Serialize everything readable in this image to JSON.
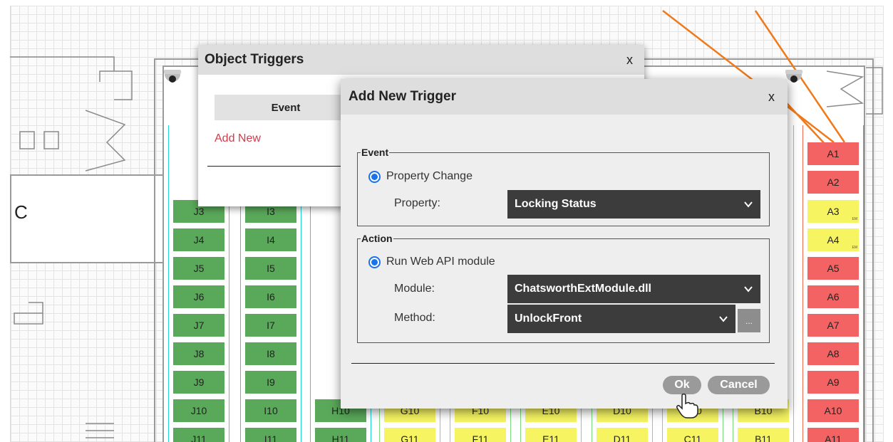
{
  "floorplan": {
    "room_label": "C",
    "rack_columns": [
      {
        "border_color": "#22d3d3",
        "slots": [
          {
            "label": "J3",
            "color": "green"
          },
          {
            "label": "J4",
            "color": "green"
          },
          {
            "label": "J5",
            "color": "green"
          },
          {
            "label": "J6",
            "color": "green"
          },
          {
            "label": "J7",
            "color": "green"
          },
          {
            "label": "J8",
            "color": "green"
          },
          {
            "label": "J9",
            "color": "green"
          },
          {
            "label": "J10",
            "color": "green"
          },
          {
            "label": "J11",
            "color": "green"
          }
        ]
      },
      {
        "border_color": "#22d3d3",
        "slots": [
          {
            "label": "I3",
            "color": "green"
          },
          {
            "label": "I4",
            "color": "green"
          },
          {
            "label": "I5",
            "color": "green"
          },
          {
            "label": "I6",
            "color": "green"
          },
          {
            "label": "I7",
            "color": "green"
          },
          {
            "label": "I8",
            "color": "green"
          },
          {
            "label": "I9",
            "color": "green"
          },
          {
            "label": "I10",
            "color": "green"
          },
          {
            "label": "I11",
            "color": "green"
          }
        ]
      },
      {
        "border_color": "#22d3d3",
        "slots": [
          {
            "label": "H10",
            "color": "green"
          },
          {
            "label": "H11",
            "color": "green"
          }
        ]
      },
      {
        "border_color": "#7ddc7d",
        "slots": [
          {
            "label": "G10",
            "color": "yellow"
          },
          {
            "label": "G11",
            "color": "yellow"
          }
        ]
      },
      {
        "border_color": "#7ddc7d",
        "slots": [
          {
            "label": "F10",
            "color": "yellow"
          },
          {
            "label": "F11",
            "color": "yellow"
          }
        ]
      },
      {
        "border_color": "#7ddc7d",
        "slots": [
          {
            "label": "E10",
            "color": "yellow"
          },
          {
            "label": "E11",
            "color": "yellow"
          }
        ]
      },
      {
        "border_color": "#7ddc7d",
        "slots": [
          {
            "label": "D10",
            "color": "yellow"
          },
          {
            "label": "D11",
            "color": "yellow"
          }
        ]
      },
      {
        "border_color": "#7ddc7d",
        "slots": [
          {
            "label": "C10",
            "color": "yellow"
          },
          {
            "label": "C11",
            "color": "yellow"
          }
        ]
      },
      {
        "border_color": "#7ddc7d",
        "slots": [
          {
            "label": "B10",
            "color": "yellow"
          },
          {
            "label": "B11",
            "color": "yellow"
          }
        ]
      },
      {
        "border_color": "#f06a50",
        "slots": [
          {
            "label": "A1",
            "color": "red"
          },
          {
            "label": "A2",
            "color": "red"
          },
          {
            "label": "A3",
            "color": "yellow",
            "tag": "EM"
          },
          {
            "label": "A4",
            "color": "yellow",
            "tag": "EM"
          },
          {
            "label": "A5",
            "color": "red"
          },
          {
            "label": "A6",
            "color": "red"
          },
          {
            "label": "A7",
            "color": "red"
          },
          {
            "label": "A8",
            "color": "red"
          },
          {
            "label": "A9",
            "color": "red"
          },
          {
            "label": "A10",
            "color": "red"
          },
          {
            "label": "A11",
            "color": "red"
          }
        ]
      }
    ],
    "colors": {
      "green": "#5aa85a",
      "yellow": "#f6f461",
      "red": "#f36363",
      "connection_line": "#f07a1a"
    }
  },
  "object_triggers_dialog": {
    "title": "Object Triggers",
    "close_label": "x",
    "table_header": "Event",
    "add_new_link": "Add New"
  },
  "add_trigger_dialog": {
    "title": "Add New Trigger",
    "close_label": "x",
    "event_group": {
      "legend": "Event",
      "option": "Property Change",
      "property_label": "Property:",
      "property_value": "Locking Status"
    },
    "action_group": {
      "legend": "Action",
      "option": "Run Web API module",
      "module_label": "Module:",
      "module_value": "ChatsworthExtModule.dll",
      "method_label": "Method:",
      "method_value": "UnlockFront",
      "more_button": "..."
    },
    "ok_button": "Ok",
    "cancel_button": "Cancel"
  }
}
